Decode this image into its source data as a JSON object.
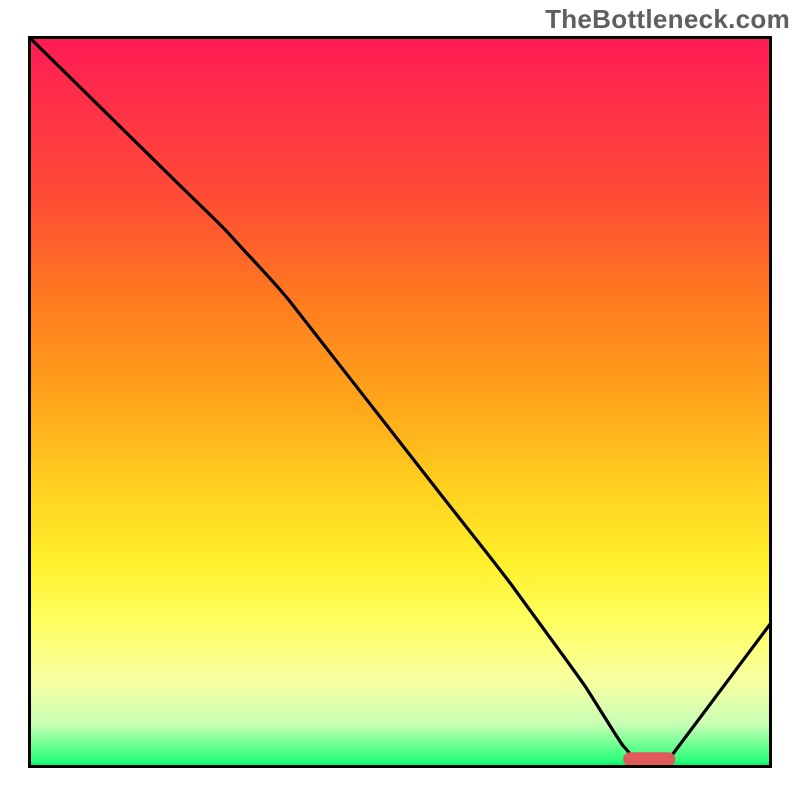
{
  "watermark": "TheBottleneck.com",
  "chart_data": {
    "type": "line",
    "title": "",
    "xlabel": "",
    "ylabel": "",
    "xlim": [
      0,
      100
    ],
    "ylim": [
      0,
      100
    ],
    "grid": false,
    "legend": false,
    "background": {
      "kind": "vertical-gradient",
      "top_color": "#ff1a55",
      "bottom_color": "#00e060",
      "meaning": "bottleneck severity (red high, green low)"
    },
    "series": [
      {
        "name": "bottleneck-curve",
        "color": "#000000",
        "x": [
          0,
          10,
          20,
          27,
          35,
          45,
          55,
          65,
          75,
          80,
          82,
          86,
          100
        ],
        "y": [
          100,
          90,
          80,
          73,
          64,
          51,
          38,
          25,
          11,
          3,
          1,
          1,
          20
        ]
      }
    ],
    "marker": {
      "name": "optimal-range",
      "shape": "rounded-bar",
      "color": "#e05a5a",
      "x_range": [
        80,
        87
      ],
      "y": 1.2
    }
  }
}
